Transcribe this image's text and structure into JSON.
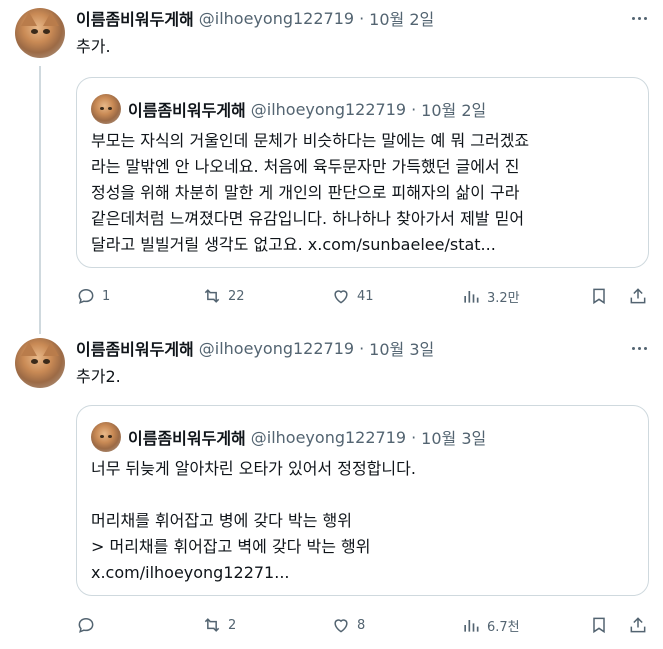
{
  "tweets": [
    {
      "author_name": "이름좀비워두게해",
      "handle": "@ilhoeyong122719",
      "separator": "·",
      "date": "10월 2일",
      "text": "추가.",
      "quote": {
        "author_name": "이름좀비워두게해",
        "handle": "@ilhoeyong122719",
        "separator": "·",
        "date": "10월 2일",
        "lines": [
          "부모는 자식의 거울인데 문체가 비슷하다는 말에는 예 뭐 그러겠죠",
          "라는 말밖엔 안 나오네요. 처음에 육두문자만 가득했던 글에서 진",
          "정성을 위해 차분히 말한 게 개인의 판단으로 피해자의 삶이 구라",
          "같은데처럼 느껴졌다면 유감입니다. 하나하나 찾아가서 제발 믿어",
          "달라고 빌빌거릴 생각도 없고요. x.com/sunbaelee/stat..."
        ]
      },
      "stats": {
        "replies": "1",
        "reposts": "22",
        "likes": "41",
        "views": "3.2만"
      }
    },
    {
      "author_name": "이름좀비워두게해",
      "handle": "@ilhoeyong122719",
      "separator": "·",
      "date": "10월 3일",
      "text": "추가2.",
      "quote": {
        "author_name": "이름좀비워두게해",
        "handle": "@ilhoeyong122719",
        "separator": "·",
        "date": "10월 3일",
        "lines": [
          "너무 뒤늦게 알아차린 오타가 있어서 정정합니다.",
          "",
          "머리채를 휘어잡고 병에 갖다 박는 행위",
          "> 머리채를 휘어잡고 벽에 갖다 박는 행위",
          "x.com/ilhoeyong12271..."
        ]
      },
      "stats": {
        "replies": "",
        "reposts": "2",
        "likes": "8",
        "views": "6.7천"
      }
    }
  ],
  "colors": {
    "text": "#0f1419",
    "muted": "#536471",
    "border": "#cfd9de"
  },
  "icons": [
    "reply-icon",
    "repost-icon",
    "like-icon",
    "views-icon",
    "bookmark-icon",
    "share-icon",
    "more-icon"
  ]
}
